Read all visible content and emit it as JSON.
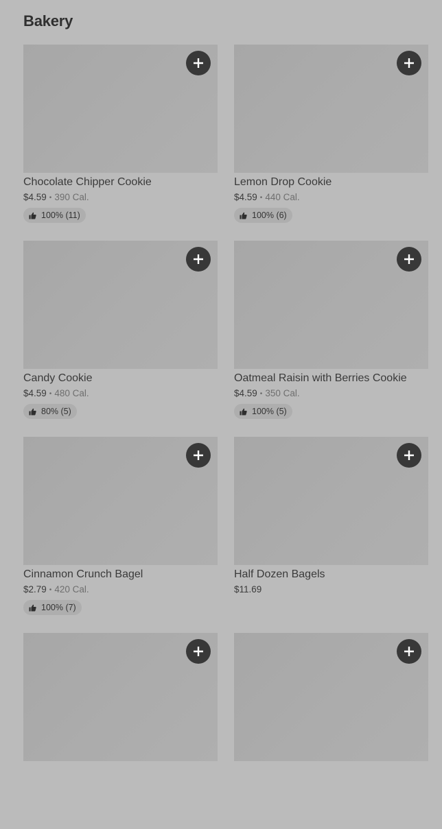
{
  "section": {
    "title": "Bakery"
  },
  "items": [
    {
      "name": "Chocolate Chipper Cookie",
      "price": "$4.59",
      "calories": "390 Cal.",
      "rating": "100% (11)"
    },
    {
      "name": "Lemon Drop Cookie",
      "price": "$4.59",
      "calories": "440 Cal.",
      "rating": "100% (6)"
    },
    {
      "name": "Candy Cookie",
      "price": "$4.59",
      "calories": "480 Cal.",
      "rating": "80% (5)"
    },
    {
      "name": "Oatmeal Raisin with Berries Cookie",
      "price": "$4.59",
      "calories": "350 Cal.",
      "rating": "100% (5)"
    },
    {
      "name": "Cinnamon Crunch Bagel",
      "price": "$2.79",
      "calories": "420 Cal.",
      "rating": "100% (7)"
    },
    {
      "name": "Half Dozen Bagels",
      "price": "$11.69"
    },
    {},
    {}
  ],
  "icons": {
    "add": "plus-icon",
    "rating": "thumbs-up-icon"
  },
  "colors": {
    "background": "#bbbbbb",
    "add_button": "#383838",
    "rating_pill": "#aeaeae"
  }
}
